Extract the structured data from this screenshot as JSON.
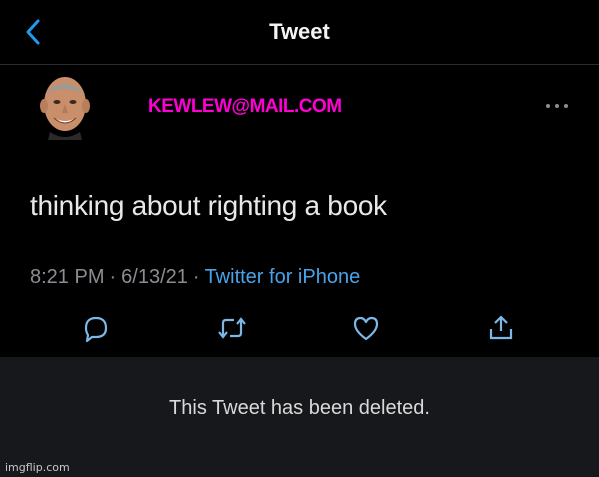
{
  "header": {
    "title": "Tweet"
  },
  "tweet": {
    "handle": "KEWLEW@MAIL.COM",
    "text": "thinking about righting a book",
    "time": "8:21 PM",
    "separator": "·",
    "date": "6/13/21",
    "source": "Twitter for iPhone"
  },
  "actions": {
    "icons": [
      "reply-icon",
      "retweet-icon",
      "like-icon",
      "share-icon"
    ]
  },
  "banner": {
    "deleted_text": "This Tweet has been deleted."
  },
  "watermark": "imgflip.com",
  "colors": {
    "background": "#000000",
    "handle": "#ff00d4",
    "link": "#4aa3ea",
    "meta": "#8a8d91",
    "icon": "#7cb7e6",
    "banner_background": "#16181c"
  }
}
